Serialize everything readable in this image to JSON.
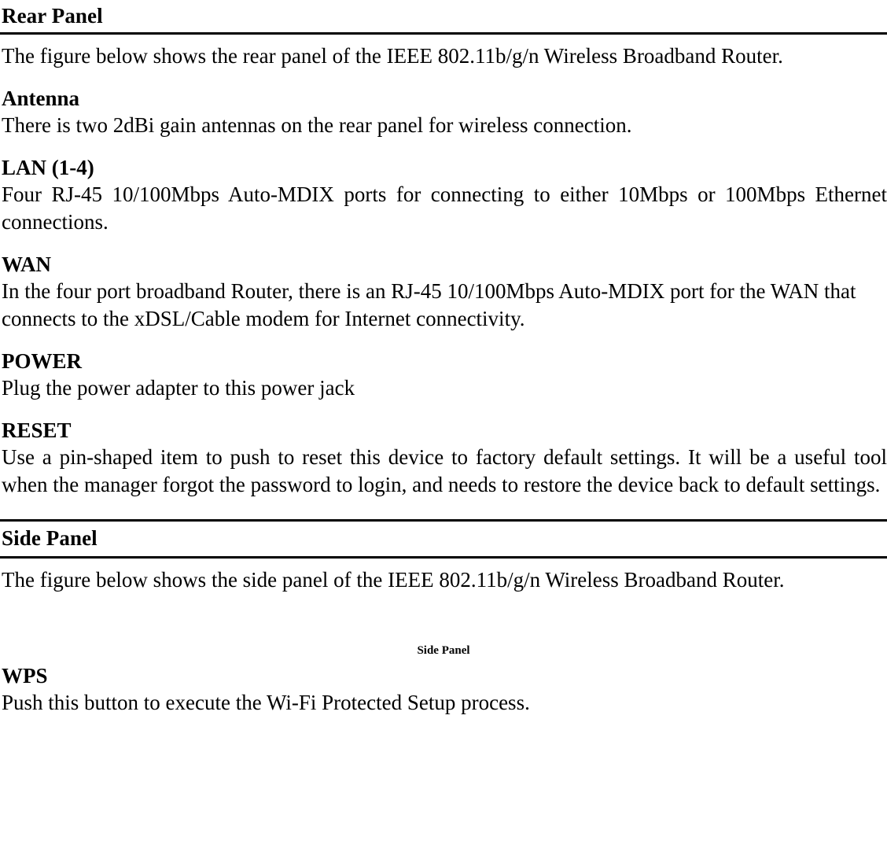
{
  "document": {
    "sections": [
      {
        "id": "rear-panel",
        "heading": "Rear Panel",
        "intro": "The figure below shows the rear panel of the IEEE 802.11b/g/n Wireless Broadband Router.",
        "subsections": [
          {
            "id": "antenna",
            "heading": "Antenna",
            "body": "There is two 2dBi gain antennas on the rear panel for wireless connection."
          },
          {
            "id": "lan",
            "heading": "LAN (1-4)",
            "body": "Four RJ-45 10/100Mbps Auto-MDIX ports for connecting to either 10Mbps or 100Mbps Ethernet connections."
          },
          {
            "id": "wan",
            "heading": "WAN",
            "body": "In the four port broadband Router, there is an RJ-45 10/100Mbps Auto-MDIX port for the WAN that connects to the xDSL/Cable modem for Internet connectivity."
          },
          {
            "id": "power",
            "heading": "POWER",
            "body": "Plug the power adapter to this power jack"
          },
          {
            "id": "reset",
            "heading": "RESET",
            "body": "Use a pin-shaped item to push to reset this device to factory default settings. It will be a useful tool when the manager forgot the password to login, and needs to restore the device back to default settings."
          }
        ]
      },
      {
        "id": "side-panel",
        "heading": "Side Panel",
        "intro": "The figure below shows the side panel of the IEEE 802.11b/g/n Wireless Broadband Router.",
        "figure_caption": "Side Panel",
        "subsections": [
          {
            "id": "wps",
            "heading": "WPS",
            "body": "Push this button to execute the Wi-Fi Protected Setup process."
          }
        ]
      }
    ]
  },
  "style": {
    "text_color": "#000000",
    "background_color": "#ffffff",
    "rule_color": "#000000"
  }
}
